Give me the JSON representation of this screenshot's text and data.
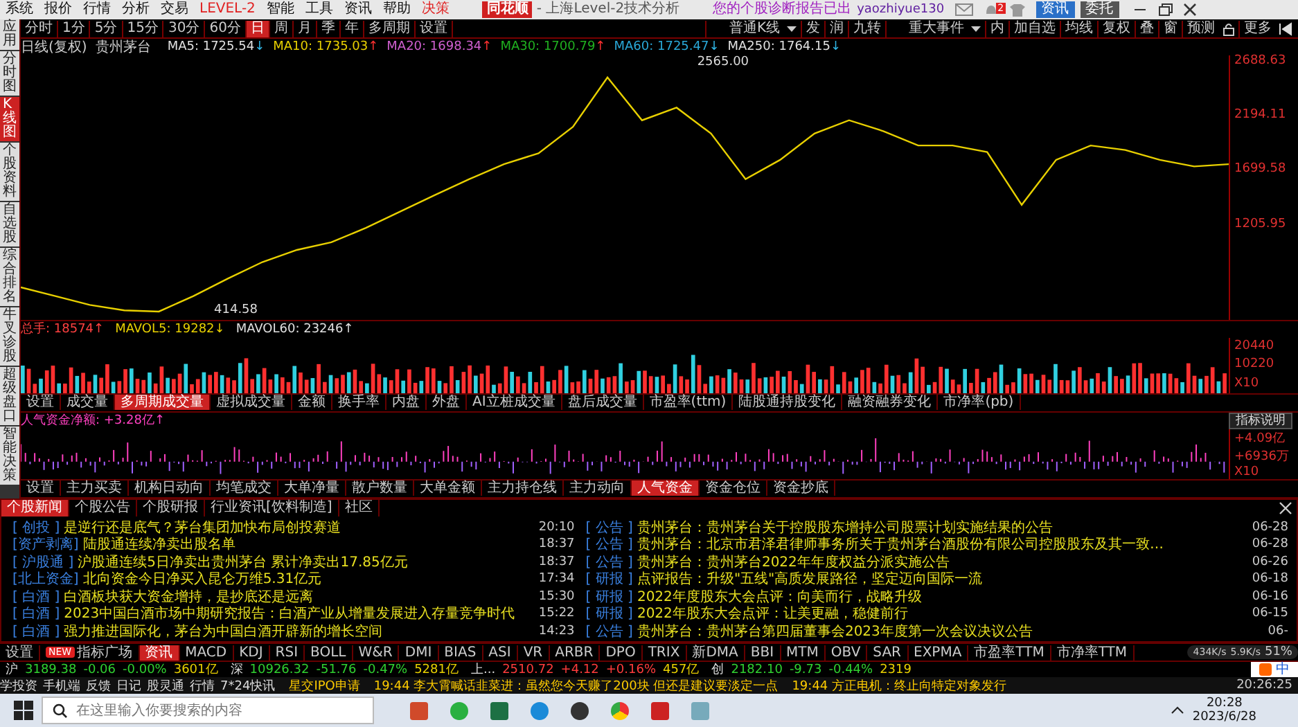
{
  "menu": {
    "items": [
      "系统",
      "报价",
      "行情",
      "分析",
      "交易",
      "LEVEL-2",
      "智能",
      "工具",
      "资讯",
      "帮助",
      "决策"
    ],
    "logo": "同花顺",
    "title": "- 上海Level-2技术分析",
    "notice": "您的个股诊断报告已出",
    "user": "yaozhiyue130",
    "bell_count": "2",
    "buttons": [
      "资讯",
      "委托"
    ]
  },
  "side_tabs": [
    {
      "label": "应用",
      "selected": false
    },
    {
      "label": "分时图",
      "selected": false
    },
    {
      "label": "K线图",
      "selected": true
    },
    {
      "label": "个股资料",
      "selected": false
    },
    {
      "label": "自选股",
      "selected": false
    },
    {
      "label": "综合排名",
      "selected": false
    },
    {
      "label": "牛叉诊股",
      "selected": false
    },
    {
      "label": "超级盘口",
      "selected": false
    },
    {
      "label": "智能决策",
      "selected": false
    }
  ],
  "period_tabs": [
    {
      "label": "分时",
      "selected": false
    },
    {
      "label": "1分",
      "selected": false
    },
    {
      "label": "5分",
      "selected": false
    },
    {
      "label": "15分",
      "selected": false
    },
    {
      "label": "30分",
      "selected": false
    },
    {
      "label": "60分",
      "selected": false
    },
    {
      "label": "日",
      "selected": true
    },
    {
      "label": "周",
      "selected": false
    },
    {
      "label": "月",
      "selected": false
    },
    {
      "label": "季",
      "selected": false
    },
    {
      "label": "年",
      "selected": false
    },
    {
      "label": "多周期",
      "selected": false
    },
    {
      "label": "设置",
      "selected": false
    }
  ],
  "chart_tools": [
    {
      "label": "普通K线",
      "kind": "dropdown"
    },
    {
      "label": "发",
      "kind": "button"
    },
    {
      "label": "润",
      "kind": "button"
    },
    {
      "label": "九转",
      "kind": "button"
    },
    {
      "label": "重大事件",
      "kind": "dropdown"
    },
    {
      "label": "内",
      "kind": "button"
    },
    {
      "label": "加自选",
      "kind": "button"
    },
    {
      "label": "均线",
      "kind": "button"
    },
    {
      "label": "复权",
      "kind": "button"
    },
    {
      "label": "叠",
      "kind": "button"
    },
    {
      "label": "窗",
      "kind": "button"
    },
    {
      "label": "预测",
      "kind": "button"
    },
    {
      "kind": "lock"
    },
    {
      "label": "更多",
      "kind": "button"
    },
    {
      "kind": "pin"
    }
  ],
  "ma_line": {
    "period": "日线(复权)",
    "stock": "贵州茅台",
    "items": [
      {
        "text": "MA5: 1725.54",
        "arrow": "↓",
        "rising": false,
        "color": "#e0e0e0"
      },
      {
        "text": "MA10: 1735.03",
        "arrow": "↑",
        "rising": true,
        "color": "#e8d000"
      },
      {
        "text": "MA20: 1698.34",
        "arrow": "↑",
        "rising": true,
        "color": "#d060d0"
      },
      {
        "text": "MA30: 1700.79",
        "arrow": "↑",
        "rising": true,
        "color": "#20b020"
      },
      {
        "text": "MA60: 1725.47",
        "arrow": "↓",
        "rising": false,
        "color": "#2aa8d8"
      },
      {
        "text": "MA250: 1764.15",
        "arrow": "↓",
        "rising": false,
        "color": "#e0e0e0"
      }
    ]
  },
  "price_chart": {
    "high_label": "2565.00",
    "low_label": "414.58",
    "chart_data": {
      "type": "line",
      "yticks": [
        {
          "value": 2688.63,
          "label": "2688.63"
        },
        {
          "value": 2194.11,
          "label": "2194.11"
        },
        {
          "value": 1699.58,
          "label": "1699.58"
        },
        {
          "value": 1205.95,
          "label": "1205.95"
        }
      ],
      "ylim": [
        350,
        2750
      ],
      "series": [
        {
          "color": "#e8d000",
          "values": [
            640,
            560,
            480,
            430,
            420,
            560,
            720,
            870,
            980,
            1050,
            1180,
            1330,
            1480,
            1625,
            1760,
            1860,
            2100,
            2550,
            2160,
            2275,
            2040,
            1625,
            1800,
            2040,
            2160,
            2060,
            1930,
            1930,
            1870,
            1390,
            1800,
            1930,
            1890,
            1800,
            1740,
            1760
          ]
        }
      ]
    }
  },
  "volume": {
    "items": [
      {
        "text": "总手: 18574↑",
        "color": "#ff4040"
      },
      {
        "text": "MAVOL5: 19282↓",
        "color": "#e8d000"
      },
      {
        "text": "MAVOL60: 23246↑",
        "color": "#e0e0e0"
      }
    ],
    "axis": [
      "20440",
      "10220",
      "X10"
    ]
  },
  "volume_tabs": [
    {
      "label": "设置",
      "selected": false
    },
    {
      "label": "成交量",
      "selected": false
    },
    {
      "label": "多周期成交量",
      "selected": true
    },
    {
      "label": "虚拟成交量",
      "selected": false
    },
    {
      "label": "金额",
      "selected": false
    },
    {
      "label": "换手率",
      "selected": false
    },
    {
      "label": "内盘",
      "selected": false
    },
    {
      "label": "外盘",
      "selected": false
    },
    {
      "label": "AI立桩成交量",
      "selected": false
    },
    {
      "label": "盘后成交量",
      "selected": false
    },
    {
      "label": "市盈率(ttm)",
      "selected": false
    },
    {
      "label": "陆股通持股变化",
      "selected": false
    },
    {
      "label": "融资融券变化",
      "selected": false
    },
    {
      "label": "市净率(pb)",
      "selected": false
    }
  ],
  "money": {
    "title": "人气资金净额: +3.28亿↑",
    "help_button": "指标说明",
    "axis": [
      "+4.09亿",
      "+6936万",
      "X10"
    ]
  },
  "money_tabs": [
    {
      "label": "设置",
      "selected": false
    },
    {
      "label": "主力买卖",
      "selected": false
    },
    {
      "label": "机构日动向",
      "selected": false
    },
    {
      "label": "均笔成交",
      "selected": false
    },
    {
      "label": "大单净量",
      "selected": false
    },
    {
      "label": "散户数量",
      "selected": false
    },
    {
      "label": "大单金额",
      "selected": false
    },
    {
      "label": "主力持仓线",
      "selected": false
    },
    {
      "label": "主力动向",
      "selected": false
    },
    {
      "label": "人气资金",
      "selected": true
    },
    {
      "label": "资金仓位",
      "selected": false
    },
    {
      "label": "资金抄底",
      "selected": false
    }
  ],
  "news_tabs": [
    {
      "label": "个股新闻",
      "selected": true
    },
    {
      "label": "个股公告",
      "selected": false
    },
    {
      "label": "个股研报",
      "selected": false
    },
    {
      "label": "行业资讯[饮料制造]",
      "selected": false
    },
    {
      "label": "社区",
      "selected": false
    }
  ],
  "news_left": [
    {
      "tag": "[ 创投 ]",
      "title": "是逆行还是底气？茅台集团加快布局创投赛道",
      "time": "20:10"
    },
    {
      "tag": "[资产剥离]",
      "title": "陆股通连续净卖出股名单",
      "time": "18:37"
    },
    {
      "tag": "[ 沪股通 ]",
      "title": "沪股通连续5日净卖出贵州茅台 累计净卖出17.85亿元",
      "time": "18:37"
    },
    {
      "tag": "[北上资金]",
      "title": "北向资金今日净买入昆仑万维5.31亿元",
      "time": "17:34"
    },
    {
      "tag": "[ 白酒 ]",
      "title": "白酒板块获大资金增持，是抄底还是远离",
      "time": "15:30"
    },
    {
      "tag": "[ 白酒 ]",
      "title": "2023中国白酒市场中期研究报告：白酒产业从增量发展进入存量竞争时代",
      "time": "15:22"
    },
    {
      "tag": "[ 白酒 ]",
      "title": "强力推进国际化，茅台为中国白酒开辟新的增长空间",
      "time": "14:23"
    }
  ],
  "news_right": [
    {
      "tag": "[ 公告 ]",
      "title": "贵州茅台：贵州茅台关于控股股东增持公司股票计划实施结果的公告",
      "time": "06-28"
    },
    {
      "tag": "[ 公告 ]",
      "title": "贵州茅台：北京市君泽君律师事务所关于贵州茅台酒股份有限公司控股股东及其一致…",
      "time": "06-28"
    },
    {
      "tag": "[ 公告 ]",
      "title": "贵州茅台：贵州茅台2022年年度权益分派实施公告",
      "time": "06-26"
    },
    {
      "tag": "[ 研报 ]",
      "title": "点评报告：升级\"五线\"高质发展路径，坚定迈向国际一流",
      "time": "06-18"
    },
    {
      "tag": "[ 研报 ]",
      "title": "2022年度股东大会点评：向美而行，战略升级",
      "time": "06-16"
    },
    {
      "tag": "[ 研报 ]",
      "title": "2022年股东大会点评：让美更融，稳健前行",
      "time": "06-15"
    },
    {
      "tag": "[ 公告 ]",
      "title": "贵州茅台：贵州茅台第四届董事会2023年度第一次会议决议公告",
      "time": "06-"
    }
  ],
  "indicator_tabs": [
    {
      "label": "设置",
      "selected": false
    },
    {
      "label": "指标广场",
      "selected": false,
      "badge": "NEW"
    },
    {
      "label": "资讯",
      "selected": true
    },
    {
      "label": "MACD",
      "selected": false
    },
    {
      "label": "KDJ",
      "selected": false
    },
    {
      "label": "RSI",
      "selected": false
    },
    {
      "label": "BOLL",
      "selected": false
    },
    {
      "label": "W&R",
      "selected": false
    },
    {
      "label": "DMI",
      "selected": false
    },
    {
      "label": "BIAS",
      "selected": false
    },
    {
      "label": "ASI",
      "selected": false
    },
    {
      "label": "VR",
      "selected": false
    },
    {
      "label": "ARBR",
      "selected": false
    },
    {
      "label": "DPO",
      "selected": false
    },
    {
      "label": "TRIX",
      "selected": false
    },
    {
      "label": "新DMA",
      "selected": false
    },
    {
      "label": "BBI",
      "selected": false
    },
    {
      "label": "MTM",
      "selected": false
    },
    {
      "label": "OBV",
      "selected": false
    },
    {
      "label": "SAR",
      "selected": false
    },
    {
      "label": "EXPMA",
      "selected": false
    },
    {
      "label": "市盈率TTM",
      "selected": false
    },
    {
      "label": "市净率TTM",
      "selected": false
    }
  ],
  "net_speed": {
    "up": "434K/s",
    "down": "5.9K/s",
    "percent": "51%"
  },
  "indices": [
    {
      "name": "沪",
      "values": [
        {
          "text": "3189.38",
          "kind": "down"
        },
        {
          "text": "-0.06",
          "kind": "down"
        },
        {
          "text": "-0.00%",
          "kind": "down"
        },
        {
          "text": "3601亿",
          "kind": "amount"
        }
      ]
    },
    {
      "name": "深",
      "values": [
        {
          "text": "10926.32",
          "kind": "down"
        },
        {
          "text": "-51.76",
          "kind": "down"
        },
        {
          "text": "-0.47%",
          "kind": "down"
        },
        {
          "text": "5281亿",
          "kind": "amount"
        }
      ]
    },
    {
      "name": "上...",
      "values": [
        {
          "text": "2510.72",
          "kind": "up"
        },
        {
          "text": "+4.12",
          "kind": "up"
        },
        {
          "text": "+0.16%",
          "kind": "up"
        },
        {
          "text": "457亿",
          "kind": "amount"
        }
      ]
    },
    {
      "name": "创",
      "values": [
        {
          "text": "2182.10",
          "kind": "down"
        },
        {
          "text": "-9.73",
          "kind": "down"
        },
        {
          "text": "-0.44%",
          "kind": "down"
        },
        {
          "text": "2319",
          "kind": "amount"
        }
      ]
    }
  ],
  "ime_bar": {
    "mode": "中"
  },
  "status_bar": {
    "links": [
      "学投资",
      "手机端",
      "反馈",
      "日记",
      "股灵通",
      "行情",
      "7*24快讯"
    ],
    "ipo": "星交IPO申请",
    "tickers": [
      "19:44 李大霄喊话韭菜进：虽然您今天赚了200块 但还是建议要淡定一点",
      "19:44 方正电机：终止向特定对象发行"
    ],
    "clock": "20:26:25"
  },
  "taskbar": {
    "search_placeholder": "在这里输入你要搜索的内容",
    "time": "20:28",
    "date": "2023/6/28"
  }
}
